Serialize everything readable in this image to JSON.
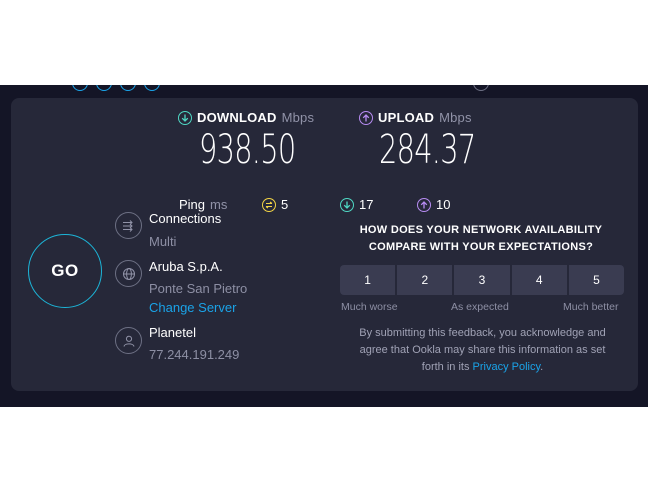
{
  "download": {
    "label": "DOWNLOAD",
    "unit": "Mbps",
    "value": "938.50"
  },
  "upload": {
    "label": "UPLOAD",
    "unit": "Mbps",
    "value": "284.37"
  },
  "ping": {
    "label": "Ping",
    "unit": "ms",
    "idle": "5",
    "download": "17",
    "upload": "10"
  },
  "go_label": "GO",
  "connections": {
    "title": "Connections",
    "value": "Multi"
  },
  "server": {
    "name": "Aruba S.p.A.",
    "location": "Ponte San Pietro",
    "change_label": "Change Server"
  },
  "isp": {
    "name": "Planetel",
    "ip": "77.244.191.249"
  },
  "survey": {
    "question_line1": "HOW DOES YOUR NETWORK AVAILABILITY",
    "question_line2": "COMPARE WITH YOUR EXPECTATIONS?",
    "options": [
      "1",
      "2",
      "3",
      "4",
      "5"
    ],
    "low_label": "Much worse",
    "mid_label": "As expected",
    "high_label": "Much better",
    "disclaimer_line1": "By submitting this feedback, you acknowledge and",
    "disclaimer_line2": "agree that Ookla may share this information as set",
    "disclaimer_line3_prefix": "forth in its",
    "privacy_link": "Privacy Policy",
    "disclaimer_line3_suffix": "."
  },
  "colors": {
    "background": "#141526",
    "card": "#262839",
    "accent_cyan": "#1cb5d8",
    "download_teal": "#4fd8c4",
    "upload_purple": "#b78cf2",
    "idle_yellow": "#f2d445",
    "link_blue": "#1aa3e8"
  },
  "icons": {
    "download": "arrow-down-circle-icon",
    "upload": "arrow-up-circle-icon",
    "ping_idle": "jitter-circle-icon",
    "connections": "connections-icon",
    "server": "globe-icon",
    "isp": "user-icon"
  }
}
